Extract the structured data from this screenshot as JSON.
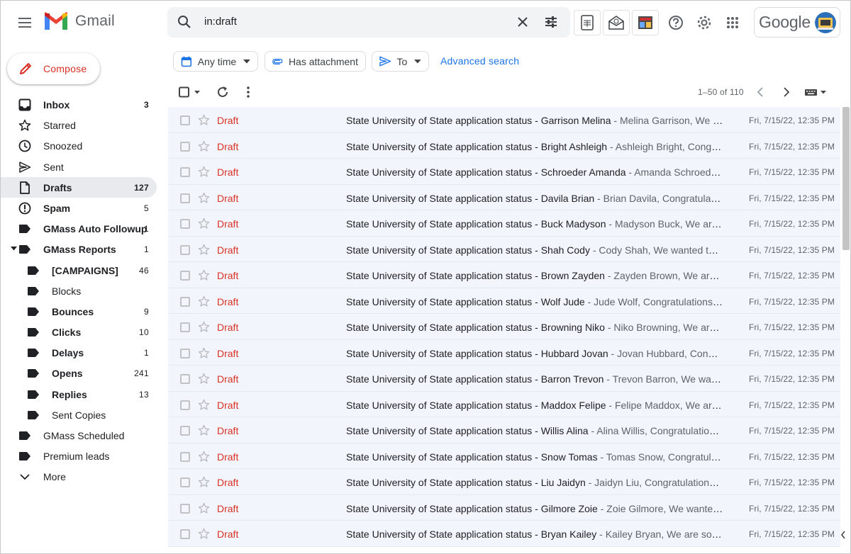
{
  "app": {
    "name": "Gmail"
  },
  "search": {
    "query": "in:draft"
  },
  "account": {
    "brand": "Google"
  },
  "compose": {
    "label": "Compose"
  },
  "sidebar": {
    "items": [
      {
        "label": "Inbox",
        "count": "3",
        "icon": "inbox-icon"
      },
      {
        "label": "Starred",
        "count": "",
        "icon": "star-icon"
      },
      {
        "label": "Snoozed",
        "count": "",
        "icon": "clock-icon"
      },
      {
        "label": "Sent",
        "count": "",
        "icon": "send-icon"
      },
      {
        "label": "Drafts",
        "count": "127",
        "icon": "draft-icon"
      },
      {
        "label": "Spam",
        "count": "5",
        "icon": "spam-icon"
      },
      {
        "label": "GMass Auto Followup",
        "count": "1",
        "icon": "label-icon"
      },
      {
        "label": "GMass Reports",
        "count": "1",
        "icon": "label-icon"
      },
      {
        "label": "[CAMPAIGNS]",
        "count": "46",
        "icon": "label-icon"
      },
      {
        "label": "Blocks",
        "count": "",
        "icon": "label-icon"
      },
      {
        "label": "Bounces",
        "count": "9",
        "icon": "label-icon"
      },
      {
        "label": "Clicks",
        "count": "10",
        "icon": "label-icon"
      },
      {
        "label": "Delays",
        "count": "1",
        "icon": "label-icon"
      },
      {
        "label": "Opens",
        "count": "241",
        "icon": "label-icon"
      },
      {
        "label": "Replies",
        "count": "13",
        "icon": "label-icon"
      },
      {
        "label": "Sent Copies",
        "count": "",
        "icon": "label-icon"
      },
      {
        "label": "GMass Scheduled",
        "count": "",
        "icon": "label-icon"
      },
      {
        "label": "Premium leads",
        "count": "",
        "icon": "label-icon"
      },
      {
        "label": "More",
        "count": "",
        "icon": "chevron-down-icon"
      }
    ]
  },
  "filters": {
    "any_time": "Any time",
    "has_attachment": "Has attachment",
    "to": "To",
    "advanced": "Advanced search"
  },
  "toolbar": {
    "pager": "1–50 of 110"
  },
  "emails": [
    {
      "sender": "Draft",
      "subject": "State University of State application status - Garrison Melina",
      "snippet": " - Melina Garrison, We are sorry to inform you",
      "date": "Fri, 7/15/22, 12:35 PM"
    },
    {
      "sender": "Draft",
      "subject": "State University of State application status - Bright Ashleigh",
      "snippet": " - Ashleigh Bright, Congratulations! You've been",
      "date": "Fri, 7/15/22, 12:35 PM"
    },
    {
      "sender": "Draft",
      "subject": "State University of State application status - Schroeder Amanda",
      "snippet": " - Amanda Schroeder, Congratulations!",
      "date": "Fri, 7/15/22, 12:35 PM"
    },
    {
      "sender": "Draft",
      "subject": "State University of State application status - Davila Brian",
      "snippet": " - Brian Davila, Congratulations! You've been",
      "date": "Fri, 7/15/22, 12:35 PM"
    },
    {
      "sender": "Draft",
      "subject": "State University of State application status - Buck Madyson",
      "snippet": " - Madyson Buck, We are sorry to inform you",
      "date": "Fri, 7/15/22, 12:35 PM"
    },
    {
      "sender": "Draft",
      "subject": "State University of State application status - Shah Cody",
      "snippet": " - Cody Shah, We wanted to inform you",
      "date": "Fri, 7/15/22, 12:35 PM"
    },
    {
      "sender": "Draft",
      "subject": "State University of State application status - Brown Zayden",
      "snippet": " - Zayden Brown, We are sorry to inform you",
      "date": "Fri, 7/15/22, 12:35 PM"
    },
    {
      "sender": "Draft",
      "subject": "State University of State application status - Wolf Jude",
      "snippet": " - Jude Wolf, Congratulations! You've been",
      "date": "Fri, 7/15/22, 12:35 PM"
    },
    {
      "sender": "Draft",
      "subject": "State University of State application status - Browning Niko",
      "snippet": " - Niko Browning, We are sorry to inform you",
      "date": "Fri, 7/15/22, 12:35 PM"
    },
    {
      "sender": "Draft",
      "subject": "State University of State application status - Hubbard Jovan",
      "snippet": " - Jovan Hubbard, Congratulations! You've been",
      "date": "Fri, 7/15/22, 12:35 PM"
    },
    {
      "sender": "Draft",
      "subject": "State University of State application status - Barron Trevon",
      "snippet": " - Trevon Barron, We wanted to inform you",
      "date": "Fri, 7/15/22, 12:35 PM"
    },
    {
      "sender": "Draft",
      "subject": "State University of State application status - Maddox Felipe",
      "snippet": " - Felipe Maddox, We are sorry to inform you",
      "date": "Fri, 7/15/22, 12:35 PM"
    },
    {
      "sender": "Draft",
      "subject": "State University of State application status - Willis Alina",
      "snippet": " - Alina Willis, Congratulations! You've been",
      "date": "Fri, 7/15/22, 12:35 PM"
    },
    {
      "sender": "Draft",
      "subject": "State University of State application status - Snow Tomas",
      "snippet": " - Tomas Snow, Congratulations! You've been",
      "date": "Fri, 7/15/22, 12:35 PM"
    },
    {
      "sender": "Draft",
      "subject": "State University of State application status - Liu Jaidyn",
      "snippet": " - Jaidyn Liu, Congratulations! You've been",
      "date": "Fri, 7/15/22, 12:35 PM"
    },
    {
      "sender": "Draft",
      "subject": "State University of State application status - Gilmore Zoie",
      "snippet": " - Zoie Gilmore, We wanted to inform you",
      "date": "Fri, 7/15/22, 12:35 PM"
    },
    {
      "sender": "Draft",
      "subject": "State University of State application status - Bryan Kailey",
      "snippet": " - Kailey Bryan, We are sorry to inform you",
      "date": "Fri, 7/15/22, 12:35 PM"
    }
  ],
  "colors": {
    "accent": "#1a73e8",
    "draft_red": "#d93025",
    "row_bg": "#f2f6fc"
  }
}
